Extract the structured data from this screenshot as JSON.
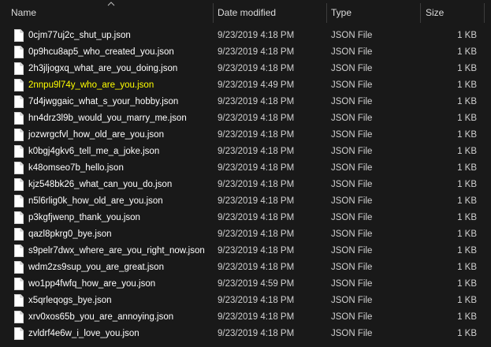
{
  "columns": {
    "name": "Name",
    "date_modified": "Date modified",
    "type": "Type",
    "size": "Size"
  },
  "files": [
    {
      "name": "0cjm77uj2c_shut_up.json",
      "date": "9/23/2019 4:18 PM",
      "type": "JSON File",
      "size": "1 KB"
    },
    {
      "name": "0p9hcu8ap5_who_created_you.json",
      "date": "9/23/2019 4:18 PM",
      "type": "JSON File",
      "size": "1 KB"
    },
    {
      "name": "2h3jljogxq_what_are_you_doing.json",
      "date": "9/23/2019 4:18 PM",
      "type": "JSON File",
      "size": "1 KB"
    },
    {
      "name": "2nnpu9l74y_who_are_you.json",
      "date": "9/23/2019 4:49 PM",
      "type": "JSON File",
      "size": "1 KB"
    },
    {
      "name": "7d4jwggaic_what_s_your_hobby.json",
      "date": "9/23/2019 4:18 PM",
      "type": "JSON File",
      "size": "1 KB"
    },
    {
      "name": "hn4drz3l9b_would_you_marry_me.json",
      "date": "9/23/2019 4:18 PM",
      "type": "JSON File",
      "size": "1 KB"
    },
    {
      "name": "jozwrgcfvl_how_old_are_you.json",
      "date": "9/23/2019 4:18 PM",
      "type": "JSON File",
      "size": "1 KB"
    },
    {
      "name": "k0bgj4gkv6_tell_me_a_joke.json",
      "date": "9/23/2019 4:18 PM",
      "type": "JSON File",
      "size": "1 KB"
    },
    {
      "name": "k48omseo7b_hello.json",
      "date": "9/23/2019 4:18 PM",
      "type": "JSON File",
      "size": "1 KB"
    },
    {
      "name": "kjz548bk26_what_can_you_do.json",
      "date": "9/23/2019 4:18 PM",
      "type": "JSON File",
      "size": "1 KB"
    },
    {
      "name": "n5l6rlig0k_how_old_are_you.json",
      "date": "9/23/2019 4:18 PM",
      "type": "JSON File",
      "size": "1 KB"
    },
    {
      "name": "p3kgfjwenp_thank_you.json",
      "date": "9/23/2019 4:18 PM",
      "type": "JSON File",
      "size": "1 KB"
    },
    {
      "name": "qazl8pkrg0_bye.json",
      "date": "9/23/2019 4:18 PM",
      "type": "JSON File",
      "size": "1 KB"
    },
    {
      "name": "s9pelr7dwx_where_are_you_right_now.json",
      "date": "9/23/2019 4:18 PM",
      "type": "JSON File",
      "size": "1 KB"
    },
    {
      "name": "wdm2zs9sup_you_are_great.json",
      "date": "9/23/2019 4:18 PM",
      "type": "JSON File",
      "size": "1 KB"
    },
    {
      "name": "wo1pp4fwfq_how_are_you.json",
      "date": "9/23/2019 4:59 PM",
      "type": "JSON File",
      "size": "1 KB"
    },
    {
      "name": "x5qrleqogs_bye.json",
      "date": "9/23/2019 4:18 PM",
      "type": "JSON File",
      "size": "1 KB"
    },
    {
      "name": "xrv0xos65b_you_are_annoying.json",
      "date": "9/23/2019 4:18 PM",
      "type": "JSON File",
      "size": "1 KB"
    },
    {
      "name": "zvldrf4e6w_i_love_you.json",
      "date": "9/23/2019 4:18 PM",
      "type": "JSON File",
      "size": "1 KB"
    }
  ],
  "highlighted_file": "2nnpu9l74y_who_are_you.json",
  "sort": {
    "column": "name",
    "direction": "ascending",
    "icon": "chevron-up-icon"
  },
  "colors": {
    "background": "#191919",
    "text": "#ffffff",
    "secondary_text": "#d0d0d0",
    "highlight_text": "#ffff00",
    "separator": "#3c3c3c"
  },
  "icons": {
    "file": "document-icon"
  }
}
